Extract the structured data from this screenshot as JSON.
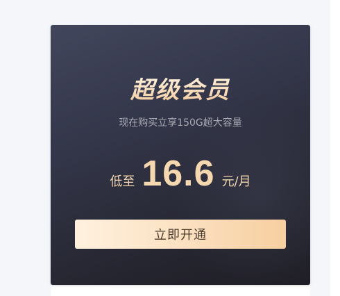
{
  "card": {
    "title": "超级会员",
    "subtitle": "现在购买立享150G超大容量",
    "price": {
      "prefix": "低至",
      "value": "16.6",
      "unit": "元/月"
    },
    "cta_label": "立即开通"
  },
  "colors": {
    "card_gradient_top": "#42465c",
    "card_gradient_bottom": "#1f1e26",
    "gold_text": "#f5d8b0",
    "subtitle_text": "#a9a9b2",
    "button_gradient_start": "#fff1df",
    "button_gradient_end": "#f7cfa0",
    "button_text": "#4a3a2c",
    "page_background": "#f4f6fa"
  }
}
